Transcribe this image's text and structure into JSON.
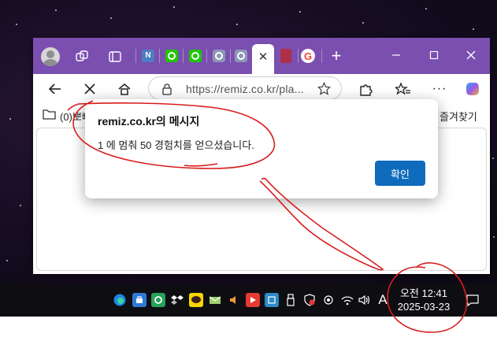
{
  "browser": {
    "tabs": [
      {
        "icon": "workspaces-icon"
      },
      {
        "icon": "tab-actions-icon"
      },
      {
        "icon": "naver-n-icon",
        "letter": "N",
        "color": "#4f7cc2"
      },
      {
        "icon": "green-site-icon",
        "color": "#1ec800"
      },
      {
        "icon": "green-site-icon",
        "color": "#1ec800"
      },
      {
        "icon": "gray-site-icon",
        "color": "#8d97b5"
      },
      {
        "icon": "gray-site-icon",
        "color": "#8d97b5"
      },
      {
        "icon": "close-icon",
        "active": true
      },
      {
        "icon": "red-book-icon",
        "color": "#b0304a"
      },
      {
        "icon": "google-g-icon",
        "letter": "G",
        "color": "#ea4335"
      }
    ],
    "address": {
      "url": "https://remiz.co.kr/pla..."
    },
    "bookmarks": {
      "left_label": "(0)뽀삐",
      "right_label": "즐겨찾기"
    },
    "colors": {
      "tabbar": "#7a4fb0",
      "accent": "#0f6cbd"
    }
  },
  "dialog": {
    "title": "remiz.co.kr의 메시지",
    "message": "1 에 멈춰 50 경험치를 얻으셨습니다.",
    "ok_label": "확인"
  },
  "taskbar": {
    "tray_icons": [
      "edge-icon",
      "store-icon",
      "app-icon",
      "dropbox-icon",
      "kakaotalk-icon",
      "mail-icon",
      "speaker-app-icon",
      "media-icon",
      "calc-icon",
      "usb-icon",
      "security-icon",
      "camera-icon",
      "wifi-icon",
      "volume-icon",
      "ime-icon"
    ],
    "ime_label": "A",
    "time": "오전 12:41",
    "date": "2025-03-23"
  }
}
